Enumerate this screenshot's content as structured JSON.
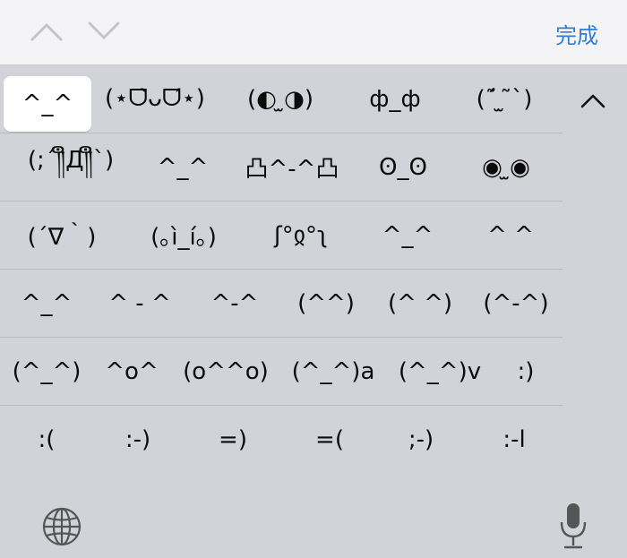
{
  "toolbar": {
    "prev_icon": "chevron-up-icon",
    "next_icon": "chevron-down-icon",
    "done_label": "完成",
    "done_color": "#2f7ed8"
  },
  "kaomoji": {
    "selected": "^_^",
    "rows": [
      [
        "^_^",
        "(⋆ᗜ̀ᴗᗜ́⋆)",
        "(◐ ̫◑)",
        "ф_ф",
        "(ˊ̃ ̫ ̃ˋ)"
      ],
      [
        "(;´༎ຶД༎ຶ`)",
        "^_^",
        "凸^-^凸",
        "ʘ_ʘ",
        "◉ ̫◉"
      ],
      [
        "(´∇｀)",
        "(｡ì_í｡)",
        "ʃ°ჲ°ʅ",
        "^_^",
        "^ ^"
      ],
      [
        "^_^",
        "^ - ^",
        "^-^",
        "(^^)",
        "(^ ^)",
        "(^-^)"
      ],
      [
        "(^_^)",
        "^o^",
        "(o^^o)",
        "(^_^)a",
        "(^_^)v",
        ":)"
      ],
      [
        ":(",
        ":-)",
        "=)",
        "=(",
        ";-)",
        ":-l"
      ]
    ]
  },
  "collapse_icon": "chevron-up-icon",
  "bottom": {
    "globe_icon": "globe-icon",
    "mic_icon": "microphone-icon"
  }
}
